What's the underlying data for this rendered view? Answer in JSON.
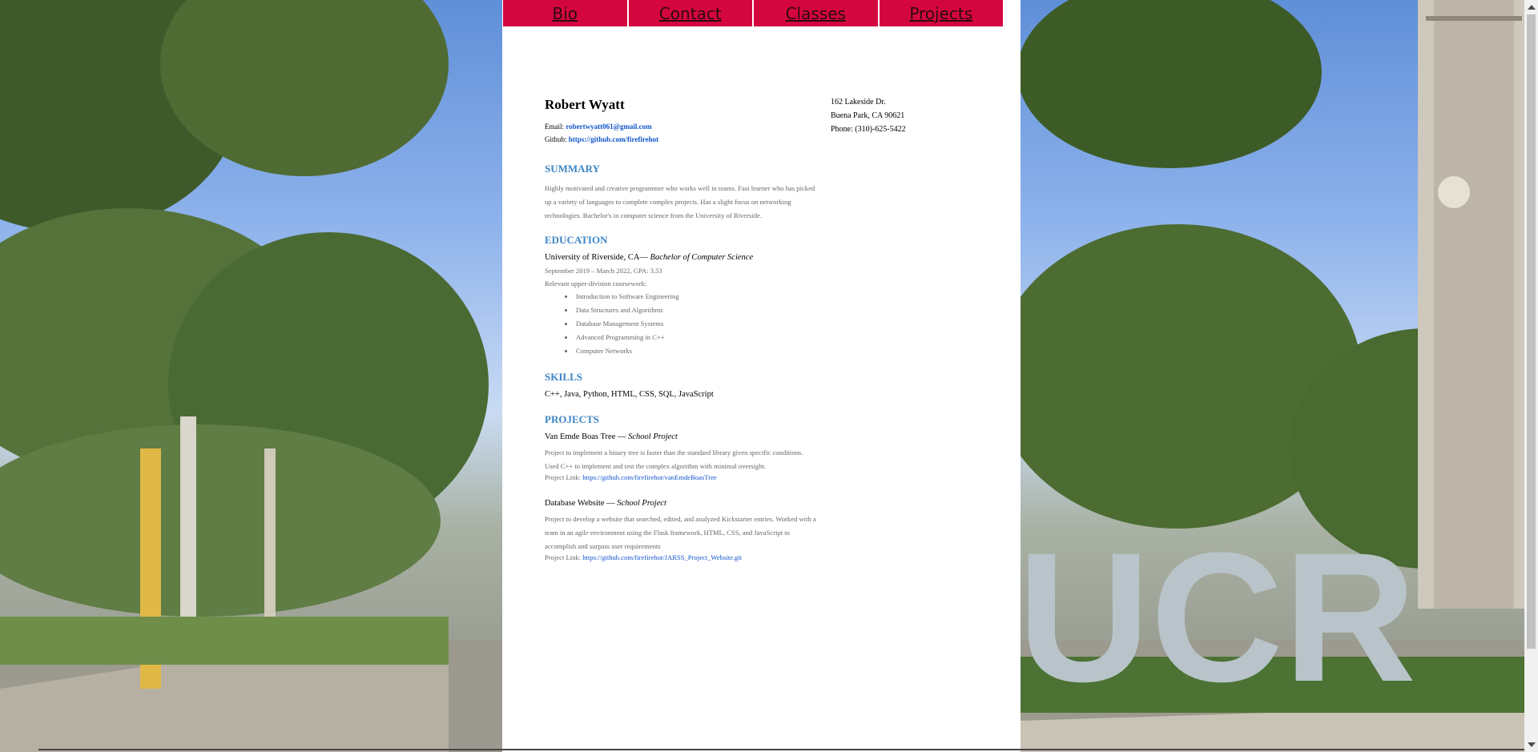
{
  "nav": {
    "items": [
      "Bio",
      "Contact",
      "Classes",
      "Projects"
    ]
  },
  "resume": {
    "name": "Robert Wyatt",
    "email_label": "Email:",
    "email": "robertwyatt061@gmail.com",
    "github_label": "Github:",
    "github": "https://github.com/firefirehot",
    "address": [
      "162 Lakeside Dr.",
      "Buena Park, CA 90621",
      "Phone: (310)-625-5422"
    ],
    "summary": {
      "heading": "SUMMARY",
      "text": "Highly motivated and creative programmer who works well in teams. Fast learner who has picked up a variety of languages to complete complex projects. Has a slight focus on networking technologies. Bachelor's in computer science from the University of Riverside."
    },
    "education": {
      "heading": "EDUCATION",
      "school": "University of Riverside, CA—",
      "degree": "Bachelor of Computer Science",
      "dates": "September 2019 – March 2022, GPA: 3.53",
      "coursework_label": "Relevant upper-division coursework:",
      "courses": [
        "Introduction to Software Engineering",
        "Data Structures and Algorithms",
        "Database Management Systems",
        "Advanced Programming in C++",
        "Computer Networks"
      ]
    },
    "skills": {
      "heading": "SKILLS",
      "text": "C++,  Java, Python, HTML, CSS, SQL, JavaScript"
    },
    "projects": {
      "heading": "PROJECTS",
      "items": [
        {
          "title": "Van Emde Boas Tree —",
          "type": "School Project",
          "description": "Project to implement a binary tree is faster than the standard library given specific conditions. Used C++ to implement and test the complex algorithm with minimal oversight.",
          "link_label": "Project Link:",
          "link": "https://github.com/firefirehot/vanEmdeBoasTree"
        },
        {
          "title": "Database Website —",
          "type": "School Project",
          "description": "Project to develop a website that searched, edited, and analyzed Kickstarter entries. Worked with a team in an agile environment using the Flask framework, HTML, CSS, and JavaScript to accomplish and surpass user requirements",
          "link_label": "Project Link:",
          "link": "https://github.com/firefirehot/JARSS_Project_Website.git"
        }
      ]
    }
  },
  "colors": {
    "nav_bg": "#d4063f",
    "section_heading": "#3d85c6",
    "link": "#1155cc"
  }
}
